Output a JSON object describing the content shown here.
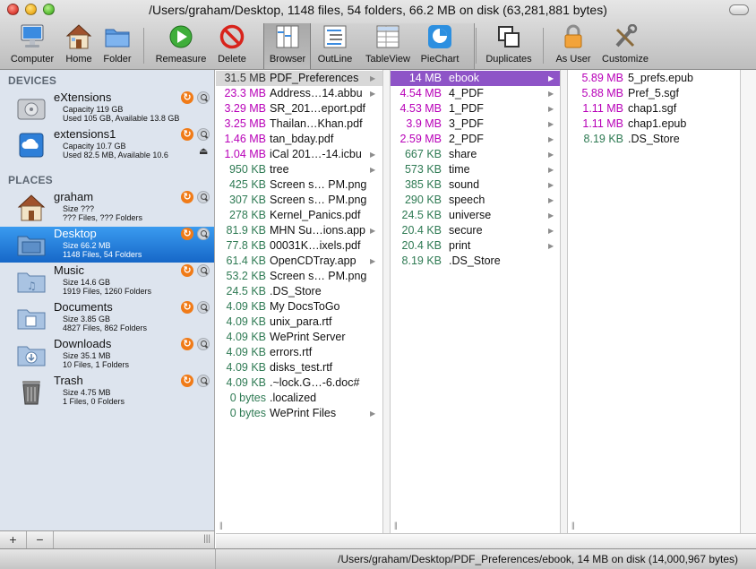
{
  "window": {
    "title": "/Users/graham/Desktop, 1148 files, 54 folders, 66.2 MB on disk (63,281,881 bytes)"
  },
  "toolbar": {
    "computer": "Computer",
    "home": "Home",
    "folder": "Folder",
    "remeasure": "Remeasure",
    "delete": "Delete",
    "browser": "Browser",
    "outline": "OutLine",
    "tableview": "TableView",
    "piechart": "PieChart",
    "duplicates": "Duplicates",
    "as_user": "As User",
    "customize": "Customize"
  },
  "sidebar": {
    "devices_header": "DEVICES",
    "places_header": "PLACES",
    "devices": [
      {
        "name": "eXtensions",
        "line1": "Capacity 119 GB",
        "line2": "Used 105 GB, Available 13.8 GB"
      },
      {
        "name": "extensions1",
        "line1": "Capacity 10.7 GB",
        "line2": "Used 82.5 MB, Available 10.6"
      }
    ],
    "places": [
      {
        "name": "graham",
        "line1": "Size ???",
        "line2": "??? Files, ??? Folders"
      },
      {
        "name": "Desktop",
        "line1": "Size 66.2 MB",
        "line2": "1148 Files, 54 Folders"
      },
      {
        "name": "Music",
        "line1": "Size 14.6 GB",
        "line2": "1919 Files, 1260 Folders"
      },
      {
        "name": "Documents",
        "line1": "Size 3.85 GB",
        "line2": "4827 Files, 862 Folders"
      },
      {
        "name": "Downloads",
        "line1": "Size 35.1 MB",
        "line2": "10 Files, 1 Folders"
      },
      {
        "name": "Trash",
        "line1": "Size 4.75 MB",
        "line2": "1 Files, 0 Folders"
      }
    ],
    "add_label": "+",
    "remove_label": "−"
  },
  "colors": {
    "size_large": "#b800b8",
    "size_small": "#2e7a53",
    "selection_purple": "#8e54c7",
    "sidebar_selection": "#1f74d6",
    "accent_orange": "#f07b18"
  },
  "columns": [
    [
      {
        "size": "31.5 MB",
        "name": "PDF_Preferences",
        "arrow": true,
        "tone": "dark",
        "state": "highlight"
      },
      {
        "size": "23.3 MB",
        "name": "Address…14.abbu",
        "arrow": true,
        "tone": "purple"
      },
      {
        "size": "3.29 MB",
        "name": "SR_201…eport.pdf",
        "arrow": false,
        "tone": "purple"
      },
      {
        "size": "3.25 MB",
        "name": "Thailan…Khan.pdf",
        "arrow": false,
        "tone": "purple"
      },
      {
        "size": "1.46 MB",
        "name": "tan_bday.pdf",
        "arrow": false,
        "tone": "purple"
      },
      {
        "size": "1.04 MB",
        "name": "iCal 201…-14.icbu",
        "arrow": true,
        "tone": "purple"
      },
      {
        "size": "950 KB",
        "name": "tree",
        "arrow": true,
        "tone": "green"
      },
      {
        "size": "425 KB",
        "name": "Screen s… PM.png",
        "arrow": false,
        "tone": "green"
      },
      {
        "size": "307 KB",
        "name": "Screen s… PM.png",
        "arrow": false,
        "tone": "green"
      },
      {
        "size": "278 KB",
        "name": "Kernel_Panics.pdf",
        "arrow": false,
        "tone": "green"
      },
      {
        "size": "81.9 KB",
        "name": "MHN Su…ions.app",
        "arrow": true,
        "tone": "green"
      },
      {
        "size": "77.8 KB",
        "name": "00031K…ixels.pdf",
        "arrow": false,
        "tone": "green"
      },
      {
        "size": "61.4 KB",
        "name": "OpenCDTray.app",
        "arrow": true,
        "tone": "green"
      },
      {
        "size": "53.2 KB",
        "name": "Screen s… PM.png",
        "arrow": false,
        "tone": "green"
      },
      {
        "size": "24.5 KB",
        "name": ".DS_Store",
        "arrow": false,
        "tone": "green"
      },
      {
        "size": "4.09 KB",
        "name": "My DocsToGo",
        "arrow": false,
        "tone": "green"
      },
      {
        "size": "4.09 KB",
        "name": "unix_para.rtf",
        "arrow": false,
        "tone": "green"
      },
      {
        "size": "4.09 KB",
        "name": "WePrint Server",
        "arrow": false,
        "tone": "green"
      },
      {
        "size": "4.09 KB",
        "name": "errors.rtf",
        "arrow": false,
        "tone": "green"
      },
      {
        "size": "4.09 KB",
        "name": "disks_test.rtf",
        "arrow": false,
        "tone": "green"
      },
      {
        "size": "4.09 KB",
        "name": ".~lock.G…-6.doc#",
        "arrow": false,
        "tone": "green"
      },
      {
        "size": "0 bytes",
        "name": ".localized",
        "arrow": false,
        "tone": "green"
      },
      {
        "size": "0 bytes",
        "name": "WePrint Files",
        "arrow": true,
        "tone": "green"
      }
    ],
    [
      {
        "size": "14 MB",
        "name": "ebook",
        "arrow": true,
        "tone": "purple",
        "state": "selected"
      },
      {
        "size": "4.54 MB",
        "name": "4_PDF",
        "arrow": true,
        "tone": "purple"
      },
      {
        "size": "4.53 MB",
        "name": "1_PDF",
        "arrow": true,
        "tone": "purple"
      },
      {
        "size": "3.9 MB",
        "name": "3_PDF",
        "arrow": true,
        "tone": "purple"
      },
      {
        "size": "2.59 MB",
        "name": "2_PDF",
        "arrow": true,
        "tone": "purple"
      },
      {
        "size": "667 KB",
        "name": "share",
        "arrow": true,
        "tone": "green"
      },
      {
        "size": "573 KB",
        "name": "time",
        "arrow": true,
        "tone": "green"
      },
      {
        "size": "385 KB",
        "name": "sound",
        "arrow": true,
        "tone": "green"
      },
      {
        "size": "290 KB",
        "name": "speech",
        "arrow": true,
        "tone": "green"
      },
      {
        "size": "24.5 KB",
        "name": "universe",
        "arrow": true,
        "tone": "green"
      },
      {
        "size": "20.4 KB",
        "name": "secure",
        "arrow": true,
        "tone": "green"
      },
      {
        "size": "20.4 KB",
        "name": "print",
        "arrow": true,
        "tone": "green"
      },
      {
        "size": "8.19 KB",
        "name": ".DS_Store",
        "arrow": false,
        "tone": "green"
      }
    ],
    [
      {
        "size": "5.89 MB",
        "name": "5_prefs.epub",
        "arrow": false,
        "tone": "purple"
      },
      {
        "size": "5.88 MB",
        "name": "Pref_5.sgf",
        "arrow": false,
        "tone": "purple"
      },
      {
        "size": "1.11 MB",
        "name": "chap1.sgf",
        "arrow": false,
        "tone": "purple"
      },
      {
        "size": "1.11 MB",
        "name": "chap1.epub",
        "arrow": false,
        "tone": "purple"
      },
      {
        "size": "8.19 KB",
        "name": ".DS_Store",
        "arrow": false,
        "tone": "green"
      }
    ]
  ],
  "status": {
    "path_text": "/Users/graham/Desktop/PDF_Preferences/ebook, 14 MB on disk (14,000,967 bytes)"
  }
}
